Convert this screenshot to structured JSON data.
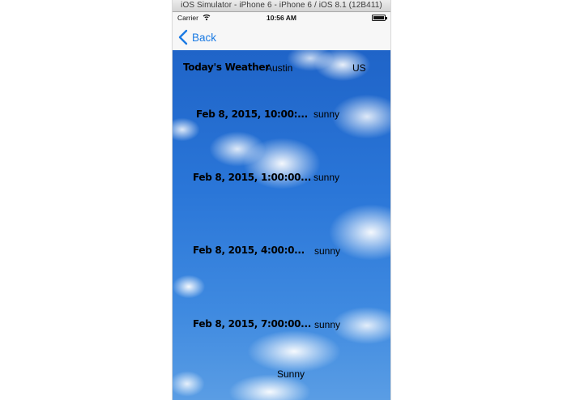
{
  "simulator": {
    "title": "iOS Simulator - iPhone 6 - iPhone 6 / iOS 8.1 (12B411)"
  },
  "status_bar": {
    "carrier": "Carrier",
    "time": "10:56 AM",
    "wifi_icon": "wifi-icon",
    "battery_icon": "battery-icon"
  },
  "nav": {
    "back_label": "Back",
    "back_icon": "chevron-left-icon",
    "accent_color": "#1a7ae3"
  },
  "weather": {
    "heading": "Today's Weather",
    "city": "Austin",
    "country": "US",
    "forecasts": [
      {
        "time": "Feb 8, 2015, 10:00:...",
        "condition": "sunny"
      },
      {
        "time": "Feb 8, 2015, 1:00:00...",
        "condition": "sunny"
      },
      {
        "time": "Feb 8, 2015, 4:00:0...",
        "condition": "sunny"
      },
      {
        "time": "Feb 8, 2015, 7:00:00...",
        "condition": "sunny"
      }
    ],
    "summary": "Sunny"
  }
}
